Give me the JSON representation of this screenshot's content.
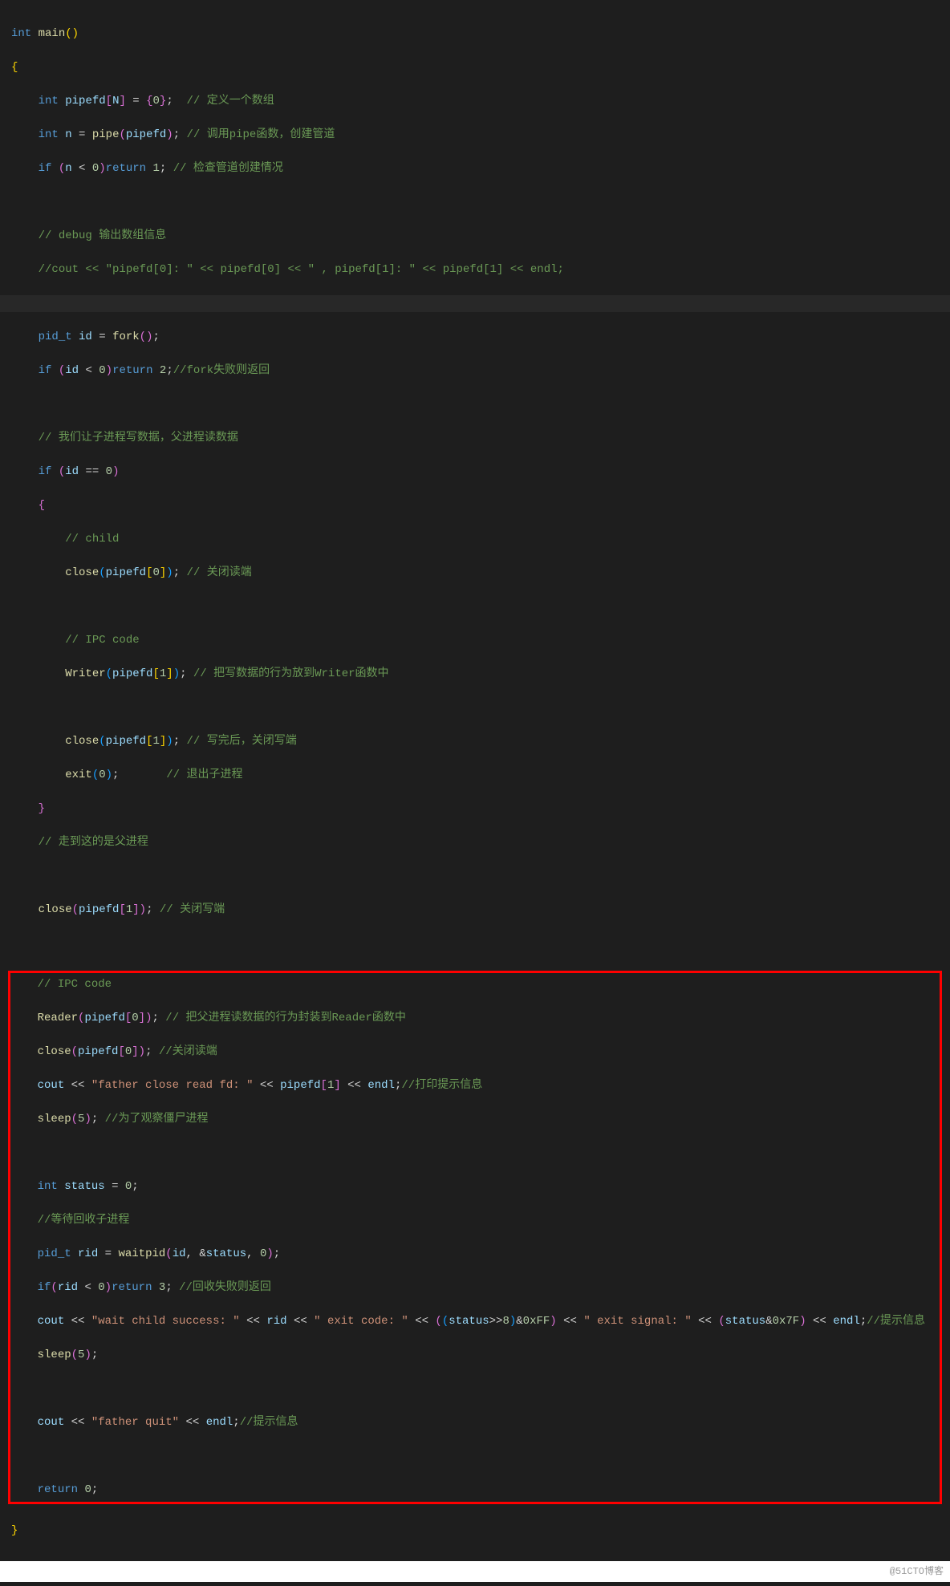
{
  "code": {
    "line1_kw_int": "int",
    "line1_func": "main",
    "line2_brace": "{",
    "line3_indent": "    ",
    "line3_kw_int": "int",
    "line3_var": "pipefd",
    "line3_N": "N",
    "line3_eq": " = ",
    "line3_zero": "0",
    "line3_comment": "// 定义一个数组",
    "line4_kw_int": "int",
    "line4_var_n": "n",
    "line4_func_pipe": "pipe",
    "line4_var_pipefd": "pipefd",
    "line4_comment": "// 调用pipe函数，创建管道",
    "line5_kw_if": "if",
    "line5_var_n": "n",
    "line5_zero": "0",
    "line5_kw_return": "return",
    "line5_one": "1",
    "line5_comment": "// 检查管道创建情况",
    "line7_comment": "// debug 输出数组信息",
    "line8_comment": "//cout << \"pipefd[0]: \" << pipefd[0] << \" , pipefd[1]: \" << pipefd[1] << endl;",
    "line10_type": "pid_t",
    "line10_var_id": "id",
    "line10_func_fork": "fork",
    "line11_kw_if": "if",
    "line11_var_id": "id",
    "line11_zero": "0",
    "line11_kw_return": "return",
    "line11_two": "2",
    "line11_comment": "//fork失败则返回",
    "line13_comment": "// 我们让子进程写数据，父进程读数据",
    "line14_kw_if": "if",
    "line14_var_id": "id",
    "line14_zero": "0",
    "line16_comment": "// child",
    "line17_func_close": "close",
    "line17_var_pipefd": "pipefd",
    "line17_zero": "0",
    "line17_comment": "// 关闭读端",
    "line19_comment": "// IPC code",
    "line20_func_writer": "Writer",
    "line20_var_pipefd": "pipefd",
    "line20_one": "1",
    "line20_comment": "// 把写数据的行为放到Writer函数中",
    "line22_func_close": "close",
    "line22_var_pipefd": "pipefd",
    "line22_one": "1",
    "line22_comment": "// 写完后，关闭写端",
    "line23_func_exit": "exit",
    "line23_zero": "0",
    "line23_comment": "// 退出子进程",
    "line25_comment": "// 走到这的是父进程",
    "line27_func_close": "close",
    "line27_var_pipefd": "pipefd",
    "line27_one": "1",
    "line27_comment": "// 关闭写端",
    "line29_comment": "// IPC code",
    "line30_func_reader": "Reader",
    "line30_var_pipefd": "pipefd",
    "line30_zero": "0",
    "line30_comment": "// 把父进程读数据的行为封装到Reader函数中",
    "line31_func_close": "close",
    "line31_var_pipefd": "pipefd",
    "line31_zero": "0",
    "line31_comment": "//关闭读端",
    "line32_var_cout": "cout",
    "line32_str": "\"father close read fd: \"",
    "line32_var_pipefd": "pipefd",
    "line32_one": "1",
    "line32_var_endl": "endl",
    "line32_comment": "//打印提示信息",
    "line33_func_sleep": "sleep",
    "line33_five": "5",
    "line33_comment": "//为了观察僵尸进程",
    "line35_kw_int": "int",
    "line35_var_status": "status",
    "line35_zero": "0",
    "line36_comment": "//等待回收子进程",
    "line37_type": "pid_t",
    "line37_var_rid": "rid",
    "line37_func_waitpid": "waitpid",
    "line37_var_id": "id",
    "line37_var_status": "status",
    "line37_zero": "0",
    "line38_kw_if": "if",
    "line38_var_rid": "rid",
    "line38_zero": "0",
    "line38_kw_return": "return",
    "line38_three": "3",
    "line38_comment": "//回收失败则返回",
    "line39_var_cout": "cout",
    "line39_str1": "\"wait child success: \"",
    "line39_var_rid": "rid",
    "line39_str2": "\" exit code: \"",
    "line39_var_status1": "status",
    "line39_eight": "8",
    "line39_hex1": "0xFF",
    "line39_str3": "\" exit signal: \"",
    "line39_var_status2": "status",
    "line39_hex2": "0x7F",
    "line39_var_endl": "endl",
    "line39_comment": "//提示信息",
    "line40_func_sleep": "sleep",
    "line40_five": "5",
    "line42_var_cout": "cout",
    "line42_str": "\"father quit\"",
    "line42_var_endl": "endl",
    "line42_comment": "//提示信息",
    "line44_kw_return": "return",
    "line44_zero": "0",
    "line45_brace": "}"
  },
  "watermark": "@51CTO博客"
}
